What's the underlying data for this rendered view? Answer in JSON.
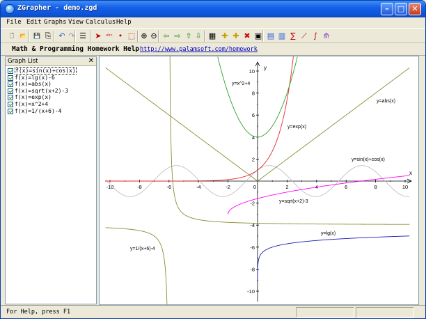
{
  "window": {
    "title": "ZGrapher - demo.zgd",
    "minimize_icon": "minimize-icon",
    "maximize_icon": "maximize-icon",
    "close_icon": "close-icon"
  },
  "menu": [
    "File",
    "Edit",
    "Graphs",
    "View",
    "Calculus",
    "Help"
  ],
  "toolbar": {
    "icons": [
      "new-file-icon",
      "open-folder-icon",
      "save-icon",
      "copy-icon",
      "undo-icon",
      "redo-icon",
      "list-icon",
      "pointer-icon",
      "text-label-icon",
      "point-icon",
      "zoom-box-icon",
      "zoom-in-icon",
      "zoom-out-icon",
      "arrow-left-icon",
      "arrow-right-icon",
      "arrow-up-icon",
      "arrow-down-icon",
      "calculator-icon",
      "add-graph-icon",
      "edit-graph-icon",
      "delete-icon",
      "properties-icon",
      "table-icon",
      "grid-icon",
      "sum-icon",
      "derivative-icon",
      "integral-icon",
      "plot-icon"
    ],
    "glyphs": [
      "🗋",
      "📂",
      "💾",
      "⎘",
      "↶",
      "↷",
      "☰",
      "➤",
      "ᵃᵇᶜ",
      "•",
      "⬚",
      "⊕",
      "⊖",
      "⇦",
      "⇨",
      "⇧",
      "⇩",
      "▦",
      "✚",
      "✚",
      "✖",
      "▣",
      "▤",
      "▥",
      "∑",
      "⟋",
      "∫",
      "⟰"
    ]
  },
  "linkbar": {
    "label": "Math & Programming Homework Help",
    "url": "http://www.palamsoft.com/homework"
  },
  "graph_list": {
    "title": "Graph List",
    "close_glyph": "✕",
    "items": [
      "f(x)=sin(x)+cos(x)",
      "f(x)=lg(x)-6",
      "f(x)=abs(x)",
      "f(x)=sqrt(x+2)-3",
      "f(x)=exp(x)",
      "f(x)=x^2+4",
      "f(x)=1/(x+6)-4"
    ]
  },
  "plot": {
    "x_axis_label": "x",
    "y_axis_label": "y",
    "x_ticks": [
      "-10",
      "-8",
      "-6",
      "-4",
      "-2",
      "0",
      "2",
      "4",
      "6",
      "8",
      "10"
    ],
    "y_ticks": [
      "10",
      "8",
      "6",
      "4",
      "2",
      "-2",
      "-4",
      "-6",
      "-8",
      "-10"
    ],
    "curve_labels": {
      "square": "y=x^2+4",
      "exp": "y=exp(x)",
      "abs": "y=abs(x)",
      "trig": "y=sin(x)+cos(x)",
      "sqrt": "y=sqrt(x+2)-3",
      "lg": "y=lg(x)",
      "recip": "y=1/(x+6)-4"
    },
    "colors": {
      "square": "#2ca02c",
      "exp": "#e8262a",
      "abs": "#8a8a30",
      "trig": "#c0c0c0",
      "sqrt": "#ff00ff",
      "lg": "#1a1ab8",
      "recip": "#8a8a30"
    }
  },
  "status": {
    "text": "For Help, press F1"
  }
}
